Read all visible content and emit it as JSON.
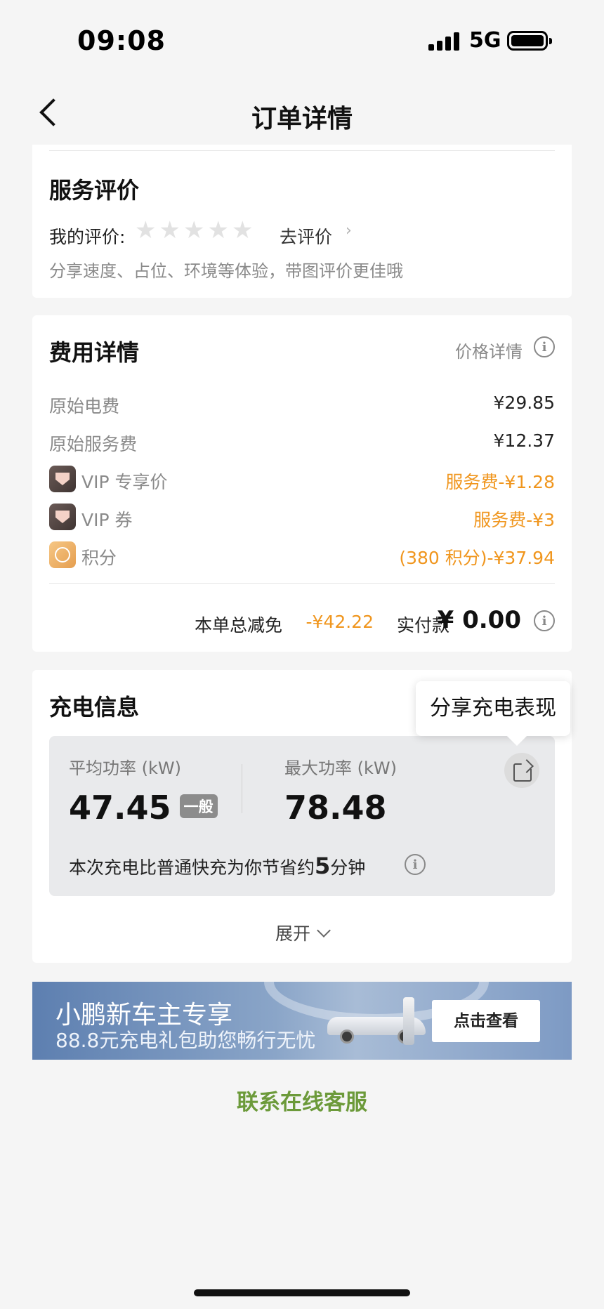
{
  "status_bar": {
    "time": "09:08",
    "network": "5G"
  },
  "nav": {
    "title": "订单详情"
  },
  "review": {
    "title": "服务评价",
    "my_rating_label": "我的评价:",
    "stars": 5,
    "rating": 0,
    "go_rate_label": "去评价",
    "hint": "分享速度、占位、环境等体验，带图评价更佳哦"
  },
  "fees": {
    "title": "费用详情",
    "price_detail_label": "价格详情",
    "rows": [
      {
        "label": "原始电费",
        "value": "¥29.85",
        "highlight": false
      },
      {
        "label": "原始服务费",
        "value": "¥12.37",
        "highlight": false
      },
      {
        "label": "VIP 专享价",
        "value": "服务费-¥1.28",
        "highlight": true,
        "icon": "vip-icon"
      },
      {
        "label": "VIP 券",
        "value": "服务费-¥3",
        "highlight": true,
        "icon": "vip-icon"
      },
      {
        "label": "积分",
        "value": "(380 积分)-¥37.94",
        "highlight": true,
        "icon": "points-icon"
      }
    ],
    "total_discount_label": "本单总减免",
    "total_discount_value": "-¥42.22",
    "paid_label": "实付款",
    "paid_value": "¥ 0.00"
  },
  "charging": {
    "title": "充电信息",
    "share_tooltip": "分享充电表现",
    "avg_power_label": "平均功率 (kW)",
    "avg_power_value": "47.45",
    "avg_power_badge": "一般",
    "max_power_label": "最大功率 (kW)",
    "max_power_value": "78.48",
    "save_prefix": "本次充电比普通快充为你节省约",
    "save_minutes": "5",
    "save_suffix": "分钟",
    "expand_label": "展开"
  },
  "banner": {
    "title": "小鹏新车主专享",
    "subtitle": "88.8元充电礼包助您畅行无忧",
    "button_label": "点击查看"
  },
  "contact_label": "联系在线客服",
  "colors": {
    "accent_orange": "#f0961e",
    "contact_green": "#6c9a3a",
    "background": "#f5f5f5"
  }
}
